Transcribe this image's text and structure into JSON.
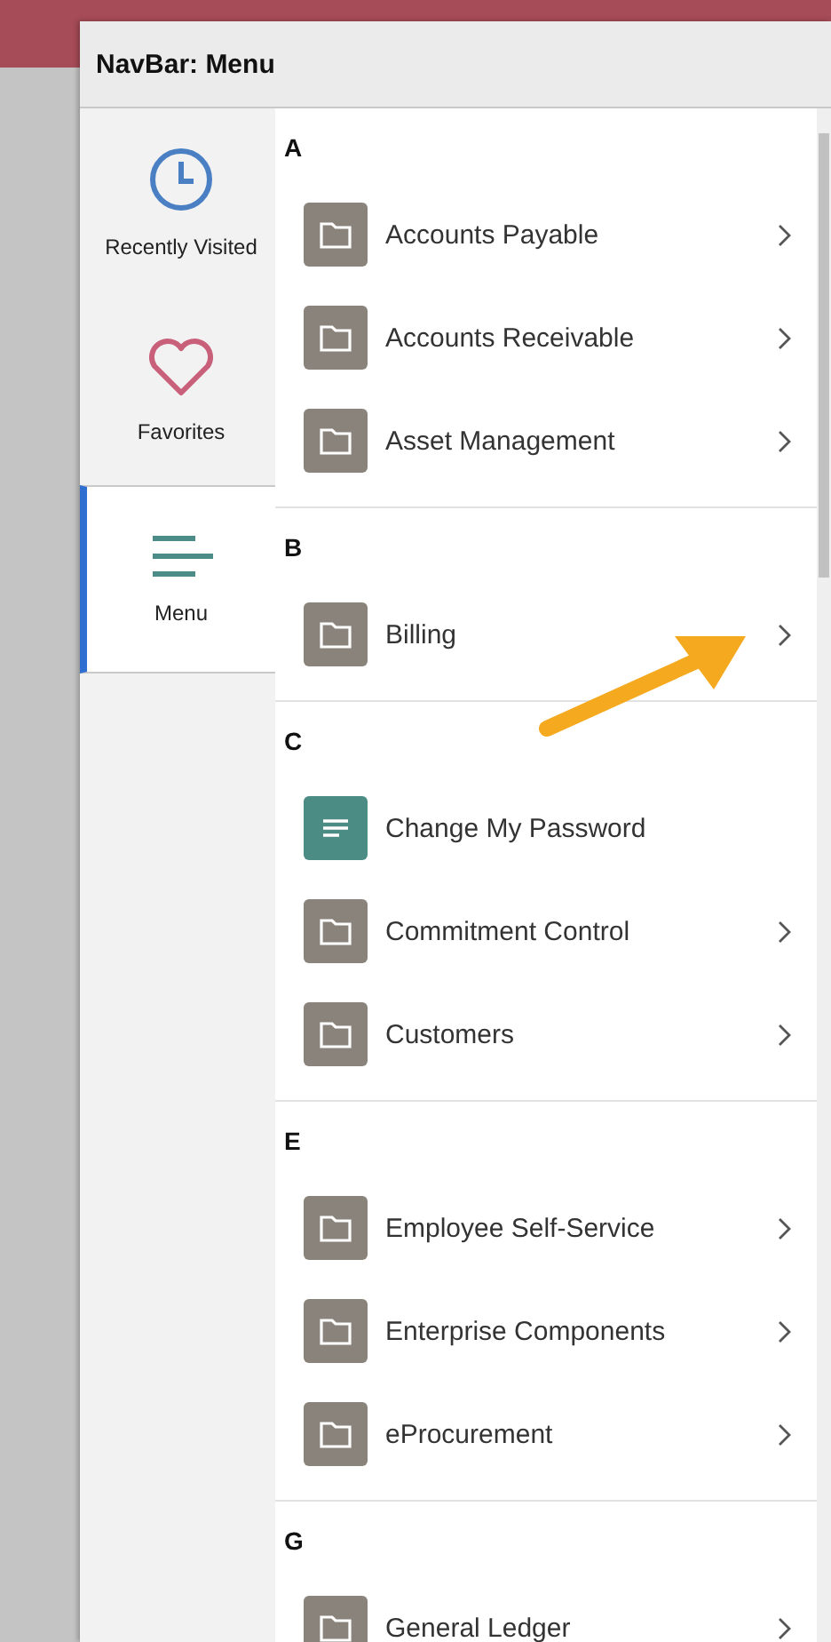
{
  "panel": {
    "title": "NavBar: Menu"
  },
  "sidebar": {
    "items": [
      {
        "label": "Recently Visited",
        "kind": "clock",
        "selected": false
      },
      {
        "label": "Favorites",
        "kind": "heart",
        "selected": false
      },
      {
        "label": "Menu",
        "kind": "menu",
        "selected": true
      }
    ]
  },
  "sections": [
    {
      "letter": "A",
      "items": [
        {
          "label": "Accounts Payable",
          "kind": "folder",
          "submenu": true
        },
        {
          "label": "Accounts Receivable",
          "kind": "folder",
          "submenu": true
        },
        {
          "label": "Asset Management",
          "kind": "folder",
          "submenu": true
        }
      ]
    },
    {
      "letter": "B",
      "items": [
        {
          "label": "Billing",
          "kind": "folder",
          "submenu": true
        }
      ]
    },
    {
      "letter": "C",
      "items": [
        {
          "label": "Change My Password",
          "kind": "page",
          "submenu": false
        },
        {
          "label": "Commitment Control",
          "kind": "folder",
          "submenu": true
        },
        {
          "label": "Customers",
          "kind": "folder",
          "submenu": true
        }
      ]
    },
    {
      "letter": "E",
      "items": [
        {
          "label": "Employee Self-Service",
          "kind": "folder",
          "submenu": true
        },
        {
          "label": "Enterprise Components",
          "kind": "folder",
          "submenu": true
        },
        {
          "label": "eProcurement",
          "kind": "folder",
          "submenu": true
        }
      ]
    },
    {
      "letter": "G",
      "items": [
        {
          "label": "General Ledger",
          "kind": "folder",
          "submenu": true
        }
      ]
    }
  ]
}
